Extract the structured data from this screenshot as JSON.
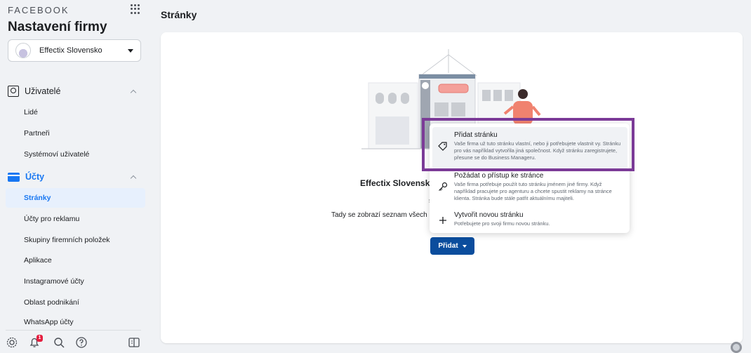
{
  "sidebar": {
    "brand": "FACEBOOK",
    "title": "Nastavení firmy",
    "business_name": "Effectix Slovensko",
    "sections": [
      {
        "label": "Uživatelé",
        "items": [
          "Lidé",
          "Partneři",
          "Systémoví uživatelé"
        ]
      },
      {
        "label": "Účty",
        "items": [
          "Stránky",
          "Účty pro reklamu",
          "Skupiny firemních položek",
          "Aplikace",
          "Instagramové účty",
          "Oblast podnikání",
          "WhatsApp účty"
        ]
      }
    ],
    "active_item": "Stránky",
    "notification_count": "1"
  },
  "main": {
    "page_title": "Stránky",
    "empty_title": "Effectix Slovensk",
    "empty_sub": "s",
    "empty_desc": "Tady se zobrazí seznam všech F",
    "add_button": "Přidat"
  },
  "dropdown": {
    "items": [
      {
        "icon": "tag-icon",
        "title": "Přidat stránku",
        "desc": "Vaše firma už tuto stránku vlastní, nebo ji potřebujete vlastnit vy. Stránku pro vás například vytvořila jiná společnost. Když stránku zaregistrujete, přesune se do Business Manageru."
      },
      {
        "icon": "key-icon",
        "title": "Požádat o přístup ke stránce",
        "desc": "Vaše firma potřebuje použít tuto stránku jménem jiné firmy. Když například pracujete pro agenturu a chcete spustit reklamy na stránce klienta. Stránka bude stále patřit aktuálnímu majiteli."
      },
      {
        "icon": "plus-icon",
        "title": "Vytvořit novou stránku",
        "desc": "Potřebujete pro svoji firmu novou stránku."
      }
    ]
  },
  "colors": {
    "accent": "#1877f2",
    "button": "#0b4d9d",
    "highlight": "#7b3a97"
  }
}
